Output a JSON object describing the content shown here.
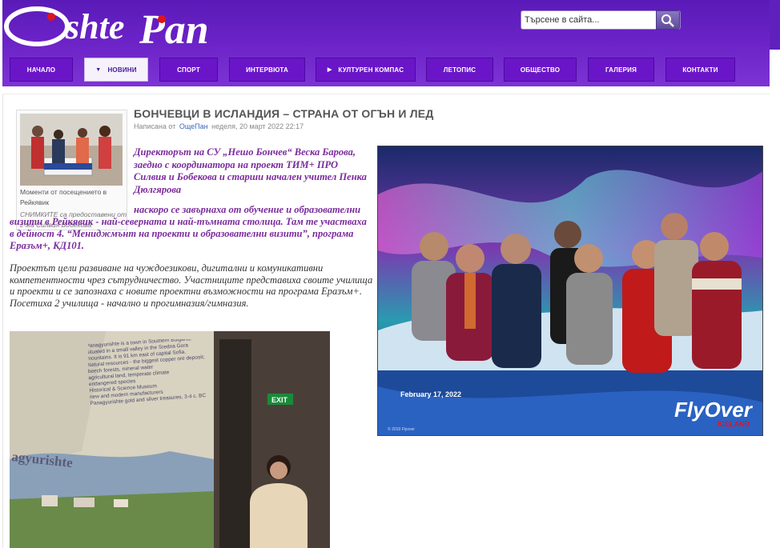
{
  "header": {
    "logo_text": "ОщеПан",
    "search": {
      "placeholder": "Търсене в сайта..."
    }
  },
  "nav": {
    "items": [
      {
        "label": "НАЧАЛО",
        "active": false,
        "dropdown": false
      },
      {
        "label": "НОВИНИ",
        "active": true,
        "dropdown": true
      },
      {
        "label": "СПОРТ",
        "active": false,
        "dropdown": false
      },
      {
        "label": "ИНТЕРВЮТА",
        "active": false,
        "dropdown": false
      },
      {
        "label": "КУЛТУРЕН КОМПАС",
        "active": false,
        "dropdown": true
      },
      {
        "label": "ЛЕТОПИС",
        "active": false,
        "dropdown": false
      },
      {
        "label": "ОБЩЕСТВО",
        "active": false,
        "dropdown": false
      },
      {
        "label": "ГАЛЕРИЯ",
        "active": false,
        "dropdown": false
      },
      {
        "label": "КОНТАКТИ",
        "active": false,
        "dropdown": false
      }
    ]
  },
  "article": {
    "title": "БОНЧЕВЦИ В ИСЛАНДИЯ – СТРАНА ОТ ОГЪН И ЛЕД",
    "meta_prefix": "Написана от",
    "author": "ОщеПан",
    "date": "неделя, 20 март 2022 22:17",
    "thumb_caption": "Моменти от посещението в Рейкявик",
    "thumb_credit": "СНИМКИТЕ са предоставени от г-жа Силвия Бобекова",
    "lead": "Директорът на СУ „Нешо Бончев“ Веска Барова, заедно с координатора на проект ТИМ+ ПРО Силвия и Бобекова и старши начален учител Пенка Дюлгярова",
    "p2_a": "наскоро се завърнаха от обучение и образователни визити в Рейкявик - най-северната и най-тъмната столица. Там те участваха в дейност 4. “Мениджмънт на",
    "p2_b": "проекти и образователни визити”, програма Еразъм+, КД101.",
    "body": "Проектът цели развиване на чуждоезикови, дигитални и комуникативни компетентности чрез сътрудничество. Участниците представиха своите училища и проекти и се запознаха с новите проектни възможности на програма Еразъм+. Посетиха 2 училища - начално и прогимназия/гимназия.",
    "photo_big": {
      "date_stamp": "February 17, 2022",
      "brand": "FlyOver",
      "brand_sub": "ICELAND",
      "copyright": "© 2019 Flyover"
    },
    "photo_small": {
      "slide_text": "Panagyurishte is a town in Southern Bulgaria, situated in a small valley in the Sredna Gora mountains. It is 91 km east of capital Sofia.",
      "slide_bullets": [
        "Natural resources - the biggest copper ore deposit; beech forests, mineral water",
        "agricultural land, temperate climate",
        "endangered species",
        "Historical & Science Museum",
        "new and modern manufacturers",
        "Panagyurishte gold and silver treasures, 3-4 c. BC"
      ],
      "slide_title": "agyurishte",
      "exit_sign": "EXIT"
    }
  }
}
